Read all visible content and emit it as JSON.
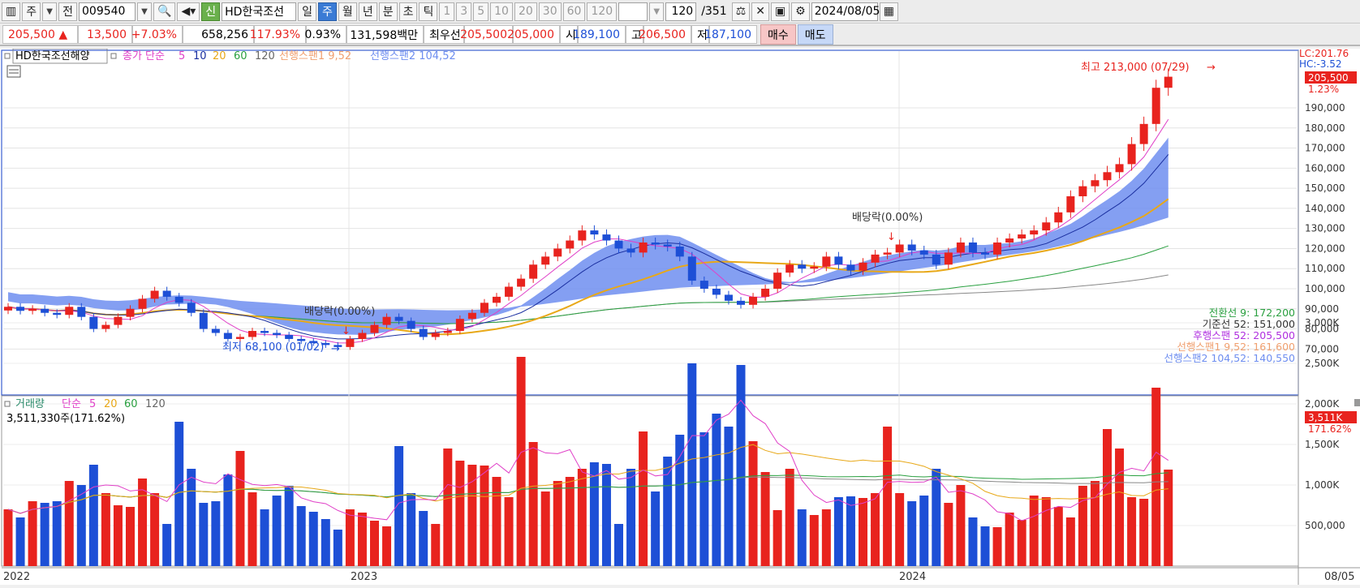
{
  "toolbar": {
    "mode": "주",
    "prev_label": "전",
    "code": "009540",
    "new_label": "신",
    "name": "HD한국조선",
    "periods": [
      "일",
      "주",
      "월",
      "년",
      "분",
      "초",
      "틱"
    ],
    "selected_period": "주",
    "intervals": [
      "1",
      "3",
      "5",
      "10",
      "20",
      "30",
      "60",
      "120"
    ],
    "count": "120",
    "total": "/351",
    "date": "2024/08/05"
  },
  "quote": {
    "price": "205,500",
    "change": "13,500",
    "change_rate": "+7.03%",
    "volume": "658,256",
    "vol_ratio": "117.93%",
    "turnover": "0.93%",
    "amount": "131,598백만",
    "pref_label": "최우선",
    "ask": "205,500",
    "bid": "205,000",
    "open_label": "시",
    "open": "189,100",
    "high_label": "고",
    "high": "206,500",
    "low_label": "저",
    "low": "187,100",
    "buy": "매수",
    "sell": "매도"
  },
  "legend": {
    "name": "HD한국조선해양",
    "ma_label": "종가 단순",
    "ma_periods": [
      "5",
      "10",
      "20",
      "60",
      "120"
    ],
    "span1": "선행스팬1 9,52",
    "span2": "선행스팬2 104,52"
  },
  "colors": {
    "up": "#e8231e",
    "down": "#1d4fd6",
    "ma5": "#e040c8",
    "ma10": "#1a2fa0",
    "ma20": "#e8a818",
    "ma60": "#2aa040",
    "ma120": "#888888",
    "cloud_up": "#f4a070",
    "cloud_down": "#6e8ef0"
  },
  "annotations": {
    "high": "최고 213,000 (07/29)",
    "low": "최저 68,100 (01/02)",
    "div1": "배당락(0.00%)",
    "div2": "배당락(0.00%)"
  },
  "right_axis": {
    "lc": "LC:201.76",
    "hc": "HC:-3.52",
    "price_tag": "205,500",
    "pct_tag": "1.23%",
    "ticks": [
      "190,000",
      "180,000",
      "170,000",
      "160,000",
      "150,000",
      "140,000",
      "130,000",
      "120,000",
      "110,000",
      "100,000",
      "90,000",
      "80,000",
      "70,000"
    ]
  },
  "ichimoku_values": {
    "tenkan": "전환선 9: 172,200",
    "kijun": "기준선 52: 151,000",
    "chikou": "후행스팬 52: 205,500",
    "span1": "선행스팬1 9,52: 161,600",
    "span2": "선행스팬2 104,52: 140,550"
  },
  "volume_panel": {
    "label": "거래량",
    "ma_label": "단순",
    "ma_periods": [
      "5",
      "20",
      "60",
      "120"
    ],
    "current": "3,511,330주(171.62%)",
    "tag": "3,511K",
    "pct_tag": "171.62%",
    "ticks": [
      "3,000K",
      "2,500K",
      "2,000K",
      "1,500K",
      "1,000K",
      "500,000"
    ]
  },
  "x_axis": {
    "years": [
      "2022",
      "2023",
      "2024"
    ],
    "end_date": "08/05"
  },
  "chart_data": {
    "type": "candlestick",
    "price_range": [
      60000,
      220000
    ],
    "closes": [
      91000,
      89000,
      90000,
      88000,
      87000,
      91000,
      86000,
      80000,
      82000,
      86000,
      90000,
      95000,
      99000,
      96000,
      93000,
      88000,
      80000,
      78000,
      75000,
      76000,
      79000,
      78000,
      77000,
      75000,
      74000,
      73000,
      72000,
      71000,
      75000,
      78000,
      82000,
      86000,
      84000,
      80000,
      76000,
      78000,
      79000,
      85000,
      88000,
      93000,
      96000,
      101000,
      105000,
      112000,
      116000,
      120000,
      124000,
      129000,
      127000,
      124000,
      120000,
      118000,
      123000,
      122000,
      121000,
      116000,
      104000,
      100000,
      97000,
      94000,
      92000,
      96000,
      100000,
      108000,
      112000,
      110000,
      111000,
      116000,
      112000,
      109000,
      113000,
      117000,
      118000,
      122000,
      119000,
      117000,
      112000,
      118000,
      123000,
      118000,
      117000,
      123000,
      125000,
      127000,
      129000,
      133000,
      138000,
      146000,
      151000,
      154000,
      158000,
      162000,
      172000,
      182000,
      200000,
      205500
    ],
    "volume_range": [
      0,
      3600000
    ],
    "volumes": [
      700000,
      600000,
      800000,
      780000,
      800000,
      1050000,
      1000000,
      1250000,
      900000,
      750000,
      730000,
      1080000,
      900000,
      520000,
      1780000,
      1200000,
      780000,
      800000,
      1130000,
      1420000,
      910000,
      700000,
      870000,
      990000,
      740000,
      670000,
      580000,
      450000,
      700000,
      660000,
      560000,
      490000,
      1480000,
      900000,
      680000,
      520000,
      1450000,
      1300000,
      1250000,
      1240000,
      1100000,
      850000,
      2580000,
      1530000,
      920000,
      1050000,
      1100000,
      1200000,
      1280000,
      1260000,
      520000,
      1200000,
      1660000,
      920000,
      1350000,
      1620000,
      2500000,
      1650000,
      1880000,
      1720000,
      2480000,
      1540000,
      1160000,
      690000,
      1200000,
      700000,
      630000,
      700000,
      850000,
      860000,
      840000,
      900000,
      1720000,
      900000,
      800000,
      870000,
      1200000,
      780000,
      1000000,
      600000,
      490000,
      480000,
      660000,
      570000,
      870000,
      850000,
      730000,
      600000,
      990000,
      1050000,
      1690000,
      1450000,
      850000,
      830000,
      2200000,
      1190000,
      760000,
      1140000,
      1120000,
      730000,
      1100000,
      2100000,
      1690000,
      1000000,
      1280000,
      2250000,
      3570000,
      2030000,
      3511330
    ]
  }
}
